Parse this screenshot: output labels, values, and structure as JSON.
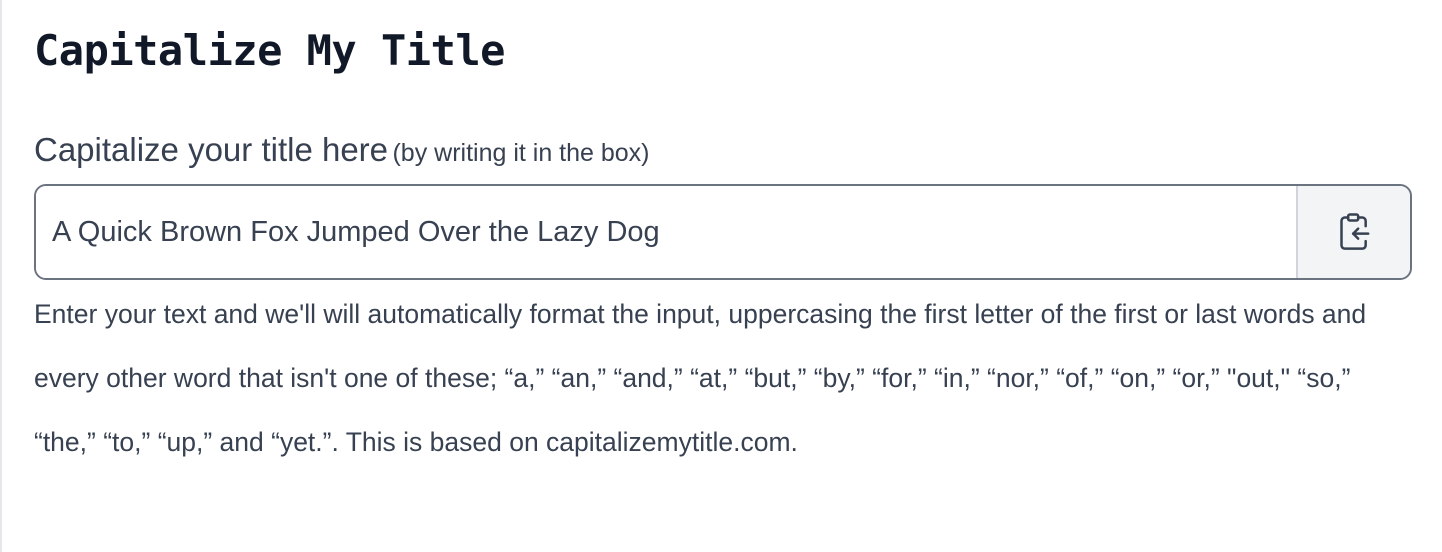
{
  "page": {
    "title": "Capitalize My Title"
  },
  "field": {
    "label": "Capitalize your title here",
    "hint": "(by writing it in the box)",
    "value": "A Quick Brown Fox Jumped Over the Lazy Dog",
    "paste_icon": "clipboard-paste-icon"
  },
  "description": "Enter your text and we'll will automatically format the input, uppercasing the first letter of the first or last words and every other word that isn't one of these; “a,” “an,” “and,” “at,” “but,” “by,” “for,” “in,” “nor,” “of,” “on,” “or,” \"out,\" “so,” “the,” “to,” “up,” and “yet.”. This is based on capitalizemytitle.com."
}
